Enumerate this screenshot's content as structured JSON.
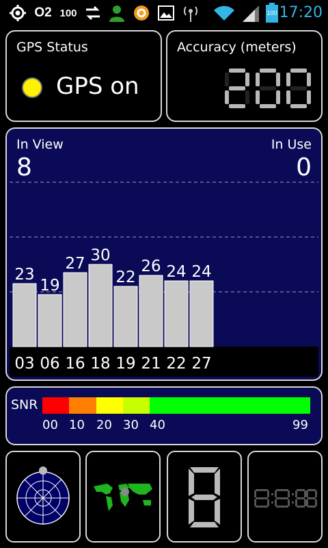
{
  "status_bar": {
    "operator": "O2",
    "signal_number": "100",
    "battery_text": "100",
    "time": "17:20"
  },
  "gps_status": {
    "title": "GPS Status",
    "state_text": "GPS on",
    "indicator_color": "#fff200"
  },
  "accuracy": {
    "title": "Accuracy (meters)",
    "value": "200"
  },
  "satellites": {
    "in_view_label": "In View",
    "in_view_value": "8",
    "in_use_label": "In Use",
    "in_use_value": "0"
  },
  "chart_data": {
    "type": "bar",
    "categories": [
      "03",
      "06",
      "16",
      "18",
      "19",
      "21",
      "22",
      "27"
    ],
    "values": [
      23,
      19,
      27,
      30,
      22,
      26,
      24,
      24
    ],
    "ylim": [
      0,
      60
    ],
    "grid": true,
    "bar_color": "#c9c9c9"
  },
  "snr": {
    "label": "SNR",
    "ticks": [
      "00",
      "10",
      "20",
      "30",
      "40",
      "99"
    ],
    "colors": [
      "#ff0000",
      "#ff8000",
      "#ffff00",
      "#c8ff00",
      "#00ff00"
    ]
  },
  "bottom_tiles": {
    "icons": [
      "radar-sky-view-icon",
      "world-map-icon",
      "digital-digit-icon",
      "digital-clock-icon"
    ]
  }
}
